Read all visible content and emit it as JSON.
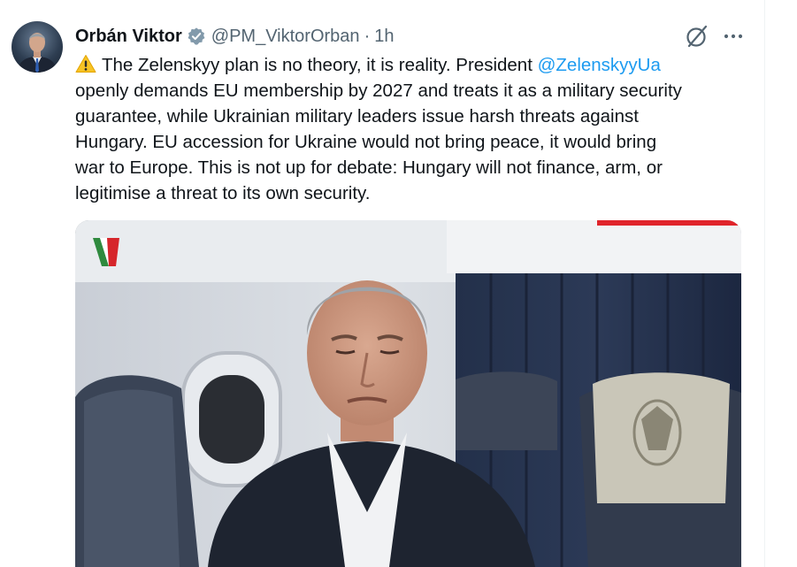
{
  "author": {
    "display_name": "Orbán Viktor",
    "handle": "@PM_ViktorOrban",
    "separator": "·",
    "time_ago": "1h",
    "verified": true,
    "avatar_icon": "person-avatar"
  },
  "tweet": {
    "lines": [
      {
        "pre": "The Zelenskyy plan is no theory, it is reality. President ",
        "mention": "@ZelenskyyUa"
      },
      {
        "text": "openly demands EU membership by 2027 and treats it as a military security"
      },
      {
        "text": "guarantee, while Ukrainian military leaders issue harsh threats against"
      },
      {
        "text": "Hungary. EU accession for Ukraine would not bring peace, it would bring"
      },
      {
        "text": "war to Europe. This is not up for debate: Hungary will not finance, arm, or"
      },
      {
        "text": "legitimise a threat to its own security."
      }
    ]
  },
  "icons": {
    "warning": "warning-icon",
    "grok": "grok-icon",
    "more": "more-icon",
    "verified": "verified-badge-icon"
  },
  "colors": {
    "link": "#1d9bf0",
    "secondary_text": "#536471",
    "primary_text": "#0f1419",
    "verified_badge": "#829aab"
  }
}
